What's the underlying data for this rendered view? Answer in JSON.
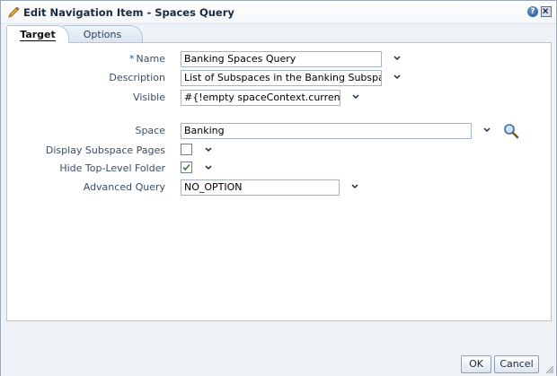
{
  "dialog": {
    "title": "Edit Navigation Item - Spaces Query",
    "title_icon": "pencil-icon",
    "help_label": "?",
    "close_icon": "close-icon"
  },
  "tabs": [
    {
      "label": "Target",
      "selected": true
    },
    {
      "label": "Options",
      "selected": false
    }
  ],
  "form": {
    "name": {
      "required_mark": "*",
      "label": "Name",
      "value": "Banking Spaces Query"
    },
    "description": {
      "label": "Description",
      "value": "List of Subspaces in the Banking Subspace"
    },
    "visible": {
      "label": "Visible",
      "value": "#{!empty spaceContext.currentSpa"
    },
    "space": {
      "label": "Space",
      "value": "Banking"
    },
    "display_subspace_pages": {
      "label": "Display Subspace Pages",
      "checked": false
    },
    "hide_top_level_folder": {
      "label": "Hide Top-Level Folder",
      "checked": true
    },
    "advanced_query": {
      "label": "Advanced Query",
      "value": "NO_OPTION"
    }
  },
  "footer": {
    "ok_label": "OK",
    "cancel_label": "Cancel"
  },
  "colors": {
    "label_text": "#3b4e64",
    "required_star": "#2a5d9f",
    "panel_border": "#b7c4d2",
    "dialog_bg": "#eef2f6"
  }
}
